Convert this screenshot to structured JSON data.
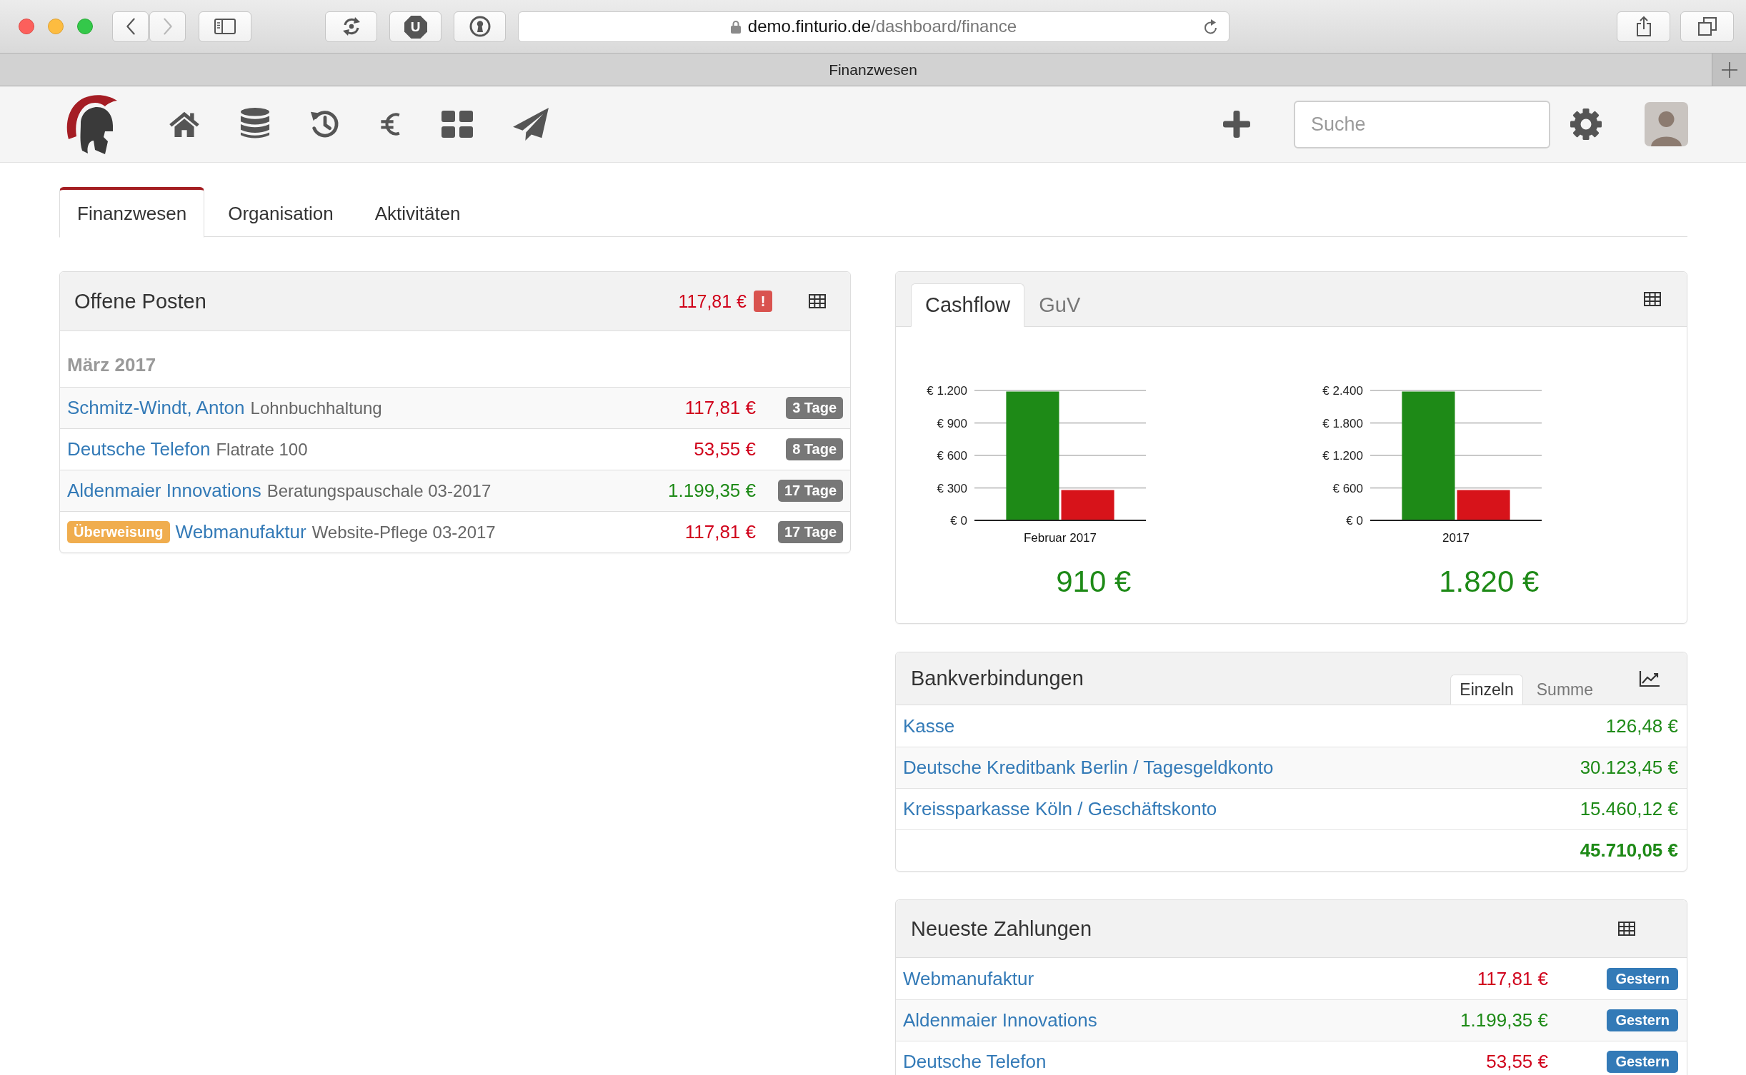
{
  "browser": {
    "nav": [
      {
        "kind": "back",
        "disabled": false
      },
      {
        "kind": "forward",
        "disabled": true
      }
    ],
    "extensions": [
      {
        "kind": "sync"
      },
      {
        "kind": "octagon",
        "letter": "U"
      },
      {
        "kind": "keyhole"
      }
    ],
    "url_domain": "demo.finturio.de",
    "url_path": "/dashboard/finance",
    "tab_title": "Finanzwesen"
  },
  "navbar": {
    "search": {
      "placeholder": "Suche"
    }
  },
  "tabs": [
    {
      "label": "Finanzwesen",
      "selected": true
    },
    {
      "label": "Organisation",
      "selected": false
    },
    {
      "label": "Aktivitäten",
      "selected": false
    }
  ],
  "open_items": {
    "title": "Offene Posten",
    "total": "117,81 €",
    "total_negative": true,
    "alert": "!",
    "month": "März 2017",
    "rows": [
      {
        "name": "Schmitz-Windt, Anton",
        "description": "Lohnbuchhaltung",
        "amount": "117,81 €",
        "negative": true,
        "due": "3 Tage"
      },
      {
        "name": "Deutsche Telefon",
        "description": "Flatrate 100",
        "amount": "53,55 €",
        "negative": true,
        "due": "8 Tage"
      },
      {
        "name": "Aldenmaier Innovations",
        "description": "Beratungspauschale 03-2017",
        "amount": "1.199,35 €",
        "negative": false,
        "due": "17 Tage"
      },
      {
        "tag": "Überweisung",
        "name": "Webmanufaktur",
        "description": "Website-Pflege 03-2017",
        "amount": "117,81 €",
        "negative": true,
        "due": "17 Tage"
      }
    ]
  },
  "cashflow": {
    "tabs": [
      {
        "label": "Cashflow",
        "selected": true
      },
      {
        "label": "GuV",
        "selected": false
      }
    ],
    "charts": [
      {
        "chart_data": {
          "type": "bar",
          "categories": [
            "Februar 2017"
          ],
          "series": [
            {
              "color": "#1e8a17",
              "values": [
                1190
              ]
            },
            {
              "color": "#d7131a",
              "values": [
                280
              ]
            }
          ],
          "ylim": [
            0,
            1200
          ],
          "yticks": [
            {
              "value": 0,
              "label": "€ 0"
            },
            {
              "value": 300,
              "label": "€ 300"
            },
            {
              "value": 600,
              "label": "€ 600"
            },
            {
              "value": 900,
              "label": "€ 900"
            },
            {
              "value": 1200,
              "label": "€ 1.200"
            }
          ],
          "grid": true
        },
        "result": "910 €",
        "negative": false
      },
      {
        "chart_data": {
          "type": "bar",
          "categories": [
            "2017"
          ],
          "series": [
            {
              "color": "#1e8a17",
              "values": [
                2380
              ]
            },
            {
              "color": "#d7131a",
              "values": [
                560
              ]
            }
          ],
          "ylim": [
            0,
            2400
          ],
          "yticks": [
            {
              "value": 0,
              "label": "€ 0"
            },
            {
              "value": 600,
              "label": "€ 600"
            },
            {
              "value": 1200,
              "label": "€ 1.200"
            },
            {
              "value": 1800,
              "label": "€ 1.800"
            },
            {
              "value": 2400,
              "label": "€ 2.400"
            }
          ],
          "grid": true
        },
        "result": "1.820 €",
        "negative": false
      }
    ]
  },
  "bank_accounts": {
    "title": "Bankverbindungen",
    "tabs": [
      {
        "label": "Einzeln",
        "selected": true
      },
      {
        "label": "Summe",
        "selected": false
      }
    ],
    "rows": [
      {
        "name": "Kasse",
        "balance": "126,48 €",
        "negative": false
      },
      {
        "name": "Deutsche Kreditbank Berlin / Tagesgeldkonto",
        "balance": "30.123,45 €",
        "negative": false
      },
      {
        "name": "Kreissparkasse Köln / Geschäftskonto",
        "balance": "15.460,12 €",
        "negative": false
      }
    ],
    "total": "45.710,05 €",
    "total_negative": false
  },
  "latest_payments": {
    "title": "Neueste Zahlungen",
    "rows": [
      {
        "name": "Webmanufaktur",
        "amount": "117,81 €",
        "negative": true,
        "date": "Gestern"
      },
      {
        "name": "Aldenmaier Innovations",
        "amount": "1.199,35 €",
        "negative": false,
        "date": "Gestern"
      },
      {
        "name": "Deutsche Telefon",
        "amount": "53,55 €",
        "negative": true,
        "date": "Gestern"
      }
    ]
  }
}
